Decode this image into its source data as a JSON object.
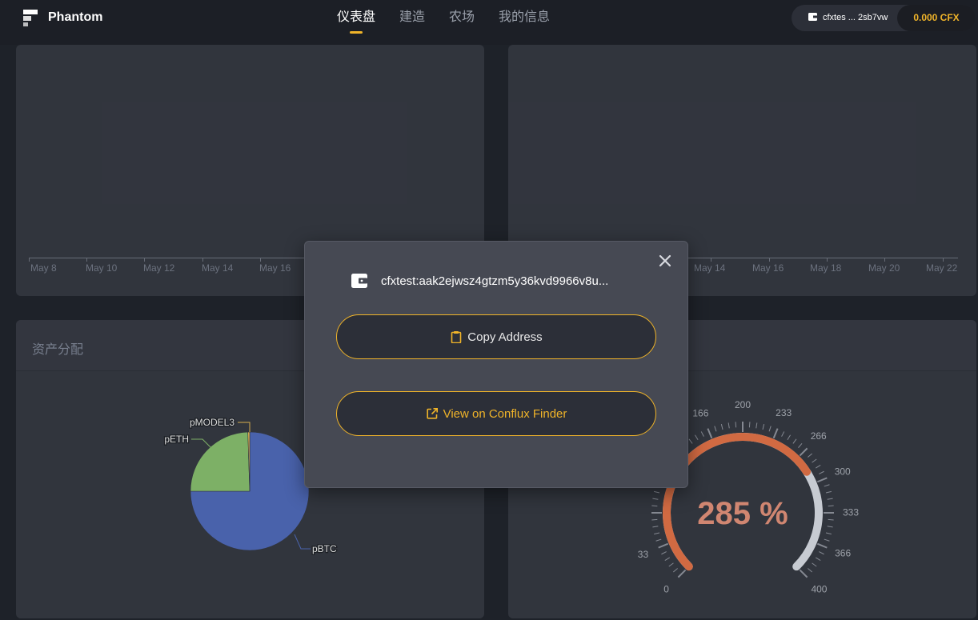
{
  "app": {
    "brand": "Phantom"
  },
  "nav": [
    {
      "label": "仪表盘",
      "active": true
    },
    {
      "label": "建造",
      "active": false
    },
    {
      "label": "农场",
      "active": false
    },
    {
      "label": "我的信息",
      "active": false
    }
  ],
  "wallet": {
    "address_short": "cfxtes ... 2sb7vw",
    "balance": "0.000 CFX",
    "icon": "wallet-icon"
  },
  "top_left_chart": {
    "x_ticks": [
      "May 8",
      "May 10",
      "May 12",
      "May 14",
      "May 16"
    ]
  },
  "top_right_chart": {
    "x_ticks": [
      "May 14",
      "May 16",
      "May 18",
      "May 20",
      "May 22"
    ]
  },
  "asset_card": {
    "title": "资产分配"
  },
  "chart_data": [
    {
      "type": "pie",
      "title": "",
      "categories": [
        "pBTC",
        "pETH",
        "pMODEL3"
      ],
      "values": [
        75,
        24.5,
        0.5
      ],
      "colors": [
        "#5470c6",
        "#91cc75",
        "#fac858"
      ]
    },
    {
      "type": "gauge",
      "value": 285,
      "value_label": "285 %",
      "min": 0,
      "max": 400,
      "tick_labels": [
        "0",
        "33",
        "166",
        "200",
        "233",
        "266",
        "300",
        "333",
        "366",
        "400"
      ],
      "progress_color": "#f47a4a",
      "track_color": "#e8ecf4"
    }
  ],
  "modal": {
    "address": "cfxtest:aak2ejwsz4gtzm5y36kvd9966v8u...",
    "copy_label": "Copy Address",
    "finder_label": "View on Conflux Finder"
  }
}
